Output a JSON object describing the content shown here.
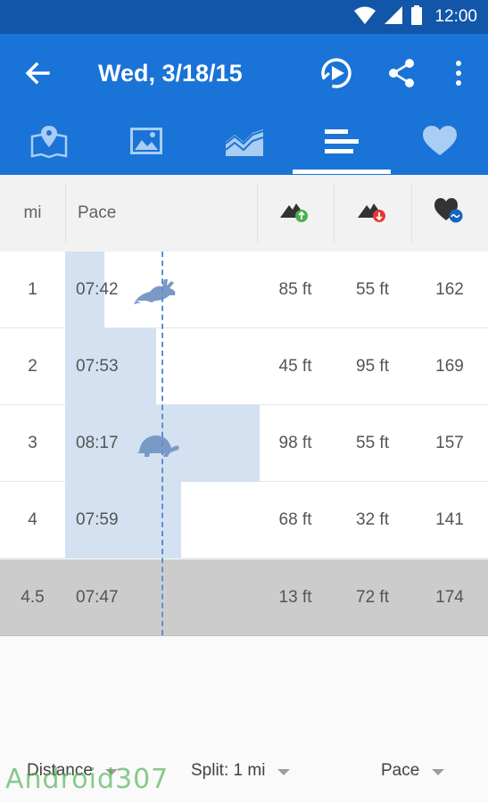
{
  "status_bar": {
    "time": "12:00",
    "icons": [
      "wifi-icon",
      "cellular-signal-icon",
      "battery-icon"
    ]
  },
  "app_bar": {
    "title": "Wed, 3/18/15",
    "actions": [
      "replay-play-icon",
      "share-icon",
      "more-vert-icon"
    ]
  },
  "tabs": [
    {
      "name": "map",
      "icon": "map-pin-icon",
      "selected": false
    },
    {
      "name": "photos",
      "icon": "image-icon",
      "selected": false
    },
    {
      "name": "charts",
      "icon": "area-chart-icon",
      "selected": false
    },
    {
      "name": "splits",
      "icon": "splits-bars-icon",
      "selected": true
    },
    {
      "name": "heart",
      "icon": "heart-icon",
      "selected": false
    }
  ],
  "table": {
    "columns": {
      "mi": "mi",
      "pace": "Pace",
      "elev_gain": "elevation-gain-icon",
      "elev_loss": "elevation-loss-icon",
      "heart_rate": "heart-rate-icon"
    },
    "rows": [
      {
        "mi": "1",
        "pace": "07:42",
        "gain": "85 ft",
        "loss": "55 ft",
        "hr": "162",
        "pace_fraction": 0.2,
        "badge": "fastest-rabbit-icon"
      },
      {
        "mi": "2",
        "pace": "07:53",
        "gain": "45 ft",
        "loss": "95 ft",
        "hr": "169",
        "pace_fraction": 0.47
      },
      {
        "mi": "3",
        "pace": "08:17",
        "gain": "98 ft",
        "loss": "55 ft",
        "hr": "157",
        "pace_fraction": 1.0,
        "badge": "slowest-turtle-icon"
      },
      {
        "mi": "4",
        "pace": "07:59",
        "gain": "68 ft",
        "loss": "32 ft",
        "hr": "141",
        "pace_fraction": 0.6
      }
    ],
    "summary": {
      "mi": "4.5",
      "pace": "07:47",
      "gain": "13 ft",
      "loss": "72 ft",
      "hr": "174"
    }
  },
  "footer": {
    "x_axis": "Distance",
    "split": "Split: 1 mi",
    "metric": "Pace"
  },
  "watermark": "Android307",
  "colors": {
    "primary": "#1a73d6",
    "status_bar": "#1156a8",
    "pace_bar": "#d3e1f1",
    "median_line": "#5b8fd4",
    "summary_row": "#cccccc",
    "gain_badge": "#4caf50",
    "loss_badge": "#e53935",
    "hr_badge": "#1565c0"
  }
}
